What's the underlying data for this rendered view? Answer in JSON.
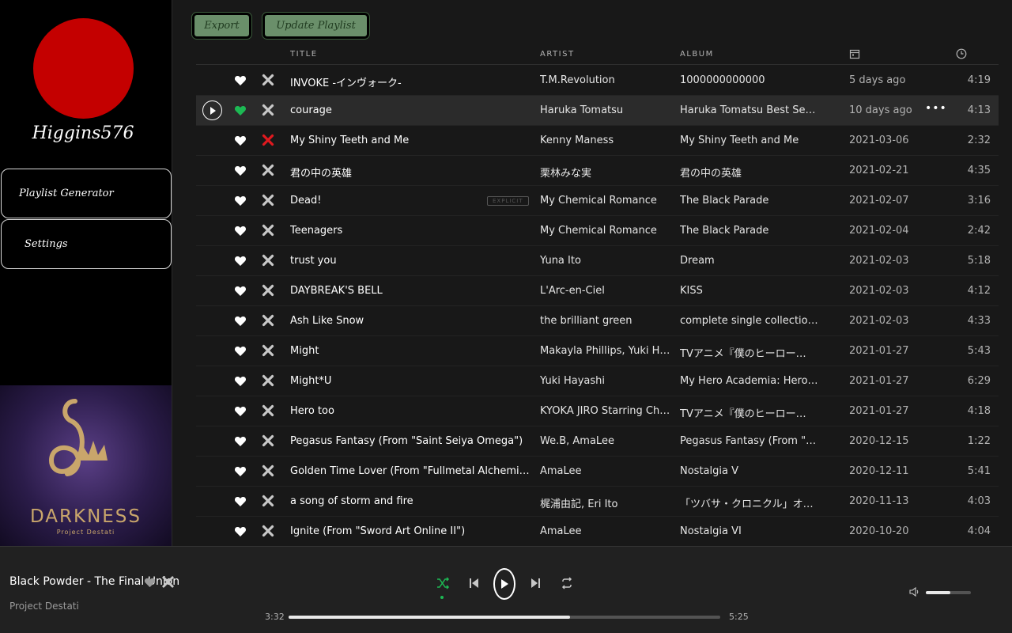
{
  "sidebar": {
    "username": "Higgins576",
    "nav": [
      {
        "label": "Playlist Generator"
      },
      {
        "label": "Settings"
      }
    ],
    "album_art": {
      "text": "DARKNESS",
      "subtext": "Project Destati"
    }
  },
  "toolbar": {
    "export_label": "Export",
    "update_label": "Update Playlist"
  },
  "table": {
    "headers": {
      "title": "TITLE",
      "artist": "ARTIST",
      "album": "ALBUM",
      "date_icon": "calendar-icon",
      "duration_icon": "clock-icon"
    },
    "rows": [
      {
        "title": "INVOKE -インヴォーク-",
        "artist": "T.M.Revolution",
        "album": "1000000000000",
        "date": "5 days ago",
        "duration": "4:19",
        "liked": false,
        "removed": false
      },
      {
        "title": "courage",
        "artist": "Haruka Tomatsu",
        "album": "Haruka Tomatsu Best Sele…",
        "date": "10 days ago",
        "duration": "4:13",
        "liked": true,
        "removed": false,
        "hovered": true
      },
      {
        "title": "My Shiny Teeth and Me",
        "artist": "Kenny Maness",
        "album": "My Shiny Teeth and Me",
        "date": "2021-03-06",
        "duration": "2:32",
        "liked": false,
        "removed": true
      },
      {
        "title": "君の中の英雄",
        "artist": "栗林みな実",
        "album": "君の中の英雄",
        "date": "2021-02-21",
        "duration": "4:35",
        "liked": false,
        "removed": false
      },
      {
        "title": "Dead!",
        "artist": "My Chemical Romance",
        "album": "The Black Parade",
        "date": "2021-02-07",
        "duration": "3:16",
        "liked": false,
        "removed": false,
        "explicit": "EXPLICIT"
      },
      {
        "title": "Teenagers",
        "artist": "My Chemical Romance",
        "album": "The Black Parade",
        "date": "2021-02-04",
        "duration": "2:42",
        "liked": false,
        "removed": false
      },
      {
        "title": "trust you",
        "artist": "Yuna Ito",
        "album": "Dream",
        "date": "2021-02-03",
        "duration": "5:18",
        "liked": false,
        "removed": false
      },
      {
        "title": "DAYBREAK'S BELL",
        "artist": "L'Arc-en-Ciel",
        "album": "KISS",
        "date": "2021-02-03",
        "duration": "4:12",
        "liked": false,
        "removed": false
      },
      {
        "title": "Ash Like Snow",
        "artist": "the brilliant green",
        "album": "complete single collection…",
        "date": "2021-02-03",
        "duration": "4:33",
        "liked": false,
        "removed": false
      },
      {
        "title": "Might",
        "artist": "Makayla Phillips, Yuki Hay…",
        "album": "TVアニメ『僕のヒーロー…",
        "date": "2021-01-27",
        "duration": "5:43",
        "liked": false,
        "removed": false
      },
      {
        "title": "Might*U",
        "artist": "Yuki Hayashi",
        "album": "My Hero Academia: Hero…",
        "date": "2021-01-27",
        "duration": "6:29",
        "liked": false,
        "removed": false
      },
      {
        "title": "Hero too",
        "artist": "KYOKA JIRO Starring Chri…",
        "album": "TVアニメ『僕のヒーロー…",
        "date": "2021-01-27",
        "duration": "4:18",
        "liked": false,
        "removed": false
      },
      {
        "title": "Pegasus Fantasy (From \"Saint Seiya Omega\")",
        "artist": "We.B, AmaLee",
        "album": "Pegasus Fantasy (From \"S…",
        "date": "2020-12-15",
        "duration": "1:22",
        "liked": false,
        "removed": false
      },
      {
        "title": "Golden Time Lover (From \"Fullmetal Alchemist: Br…",
        "artist": "AmaLee",
        "album": "Nostalgia V",
        "date": "2020-12-11",
        "duration": "5:41",
        "liked": false,
        "removed": false
      },
      {
        "title": "a song of storm and fire",
        "artist": "梶浦由記, Eri Ito",
        "album": "「ツバサ・クロニクル」オ…",
        "date": "2020-11-13",
        "duration": "4:03",
        "liked": false,
        "removed": false
      },
      {
        "title": "Ignite (From \"Sword Art Online II\")",
        "artist": "AmaLee",
        "album": "Nostalgia VI",
        "date": "2020-10-20",
        "duration": "4:04",
        "liked": false,
        "removed": false
      }
    ]
  },
  "player": {
    "track": "Black Powder - The Final Union",
    "artist": "Project Destati",
    "current_time": "3:32",
    "total_time": "5:25",
    "progress_fraction": 0.652,
    "volume_fraction": 0.55,
    "shuffle_on": true
  },
  "colors": {
    "accent_green": "#1db954",
    "remove_red": "#e0191f",
    "avatar_red": "#c40000",
    "button_green": "#6a8f6a"
  }
}
